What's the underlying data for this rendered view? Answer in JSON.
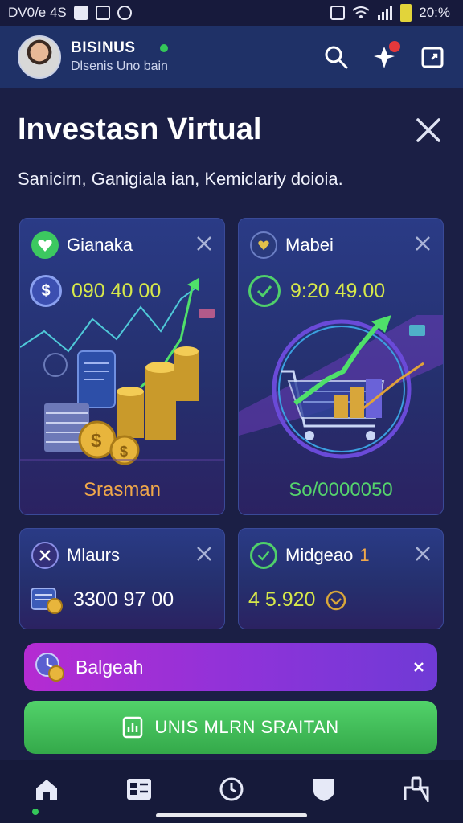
{
  "status_bar": {
    "left_text": "DV0/e 4S",
    "right_text": "20:%",
    "icons": [
      "image-icon",
      "square-icon",
      "speed-icon",
      "sim-icon",
      "signal-icon",
      "wifi-icon",
      "battery-icon"
    ]
  },
  "header": {
    "brand_name": "BISINUS",
    "brand_sub": "Dlsenis Uno bain",
    "actions": [
      "search-icon",
      "notification-icon",
      "share-icon"
    ],
    "colors": {
      "bar": "#1f3167",
      "badge": "#e5383b",
      "online": "#34c759"
    }
  },
  "page": {
    "title": "Investasn Virtual",
    "subtitle": "Sanicirn, Ganigiala ian, Kemiclariy doioia."
  },
  "cards": [
    {
      "title": "Gianaka",
      "value": "090 40 00",
      "footer": "Srasman",
      "value_color": "#d7e84a",
      "footer_color": "#f0a84a"
    },
    {
      "title": "Mabei",
      "value": "9:20 49.00",
      "footer": "So/0000050",
      "value_color": "#d7e84a",
      "footer_color": "#55d36c"
    },
    {
      "title": "Mlaurs",
      "value": "3300 97 00",
      "value_color": "#ffffff"
    },
    {
      "title": "Midgeao",
      "title_suffix": "1",
      "value": "4 5.920",
      "value_color": "#d7e84a"
    }
  ],
  "banner": {
    "label": "Balgeah",
    "color": "#b52bd2"
  },
  "cta": {
    "label": "UNIS MLRN SRAITAN",
    "color": "#45c15a"
  },
  "bottom_nav": [
    "home-icon",
    "portfolio-icon",
    "history-icon",
    "shield-icon",
    "profile-icon"
  ]
}
